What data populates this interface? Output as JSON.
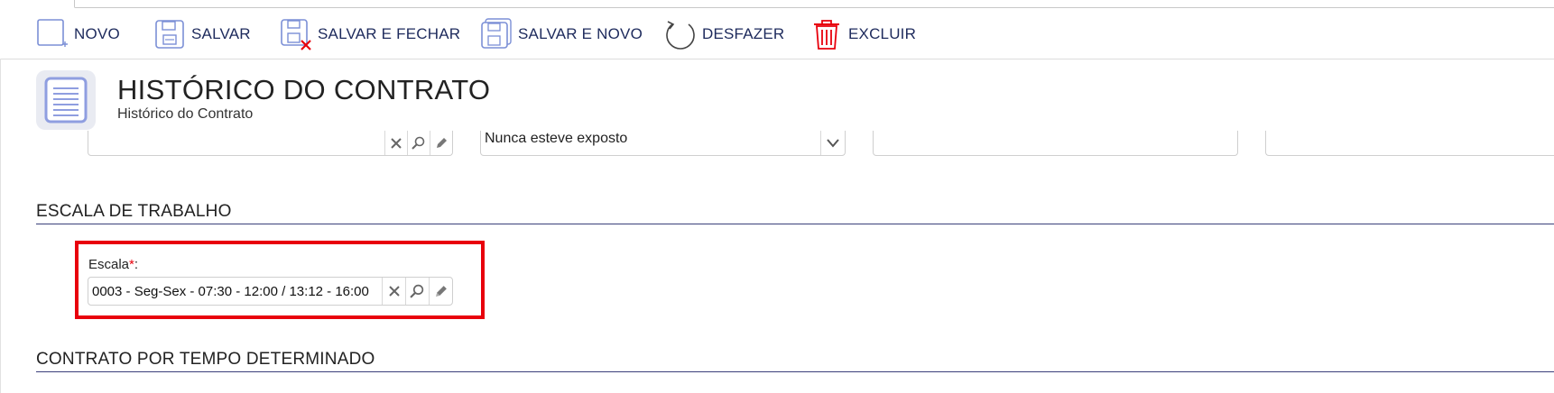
{
  "toolbar": {
    "novo": "NOVO",
    "salvar": "SALVAR",
    "salvar_fechar": "SALVAR E FECHAR",
    "salvar_novo": "SALVAR E NOVO",
    "desfazer": "DESFAZER",
    "excluir": "EXCLUIR"
  },
  "header": {
    "title": "HISTÓRICO DO CONTRATO",
    "subtitle": "Histórico do Contrato"
  },
  "prev_row": {
    "exposure_select_value": "Nunca esteve exposto"
  },
  "sections": {
    "escala": "ESCALA DE TRABALHO",
    "contrato": "CONTRATO POR TEMPO DETERMINADO"
  },
  "escala_field": {
    "label": "Escala",
    "required_mark": "*",
    "label_suffix": ":",
    "value": "0003 - Seg-Sex - 07:30 - 12:00 / 13:12 - 16:00"
  },
  "icons": {
    "new": "new-document-icon",
    "save": "floppy-disk-icon",
    "save_close": "save-close-icon",
    "save_new": "save-new-icon",
    "undo": "undo-icon",
    "delete": "trash-icon",
    "clear": "clear-x-icon",
    "search": "magnifier-icon",
    "edit": "pencil-icon"
  },
  "colors": {
    "accent": "#1d2a5c",
    "highlight": "#e8000c",
    "icon_blue": "#7b8fd6"
  }
}
